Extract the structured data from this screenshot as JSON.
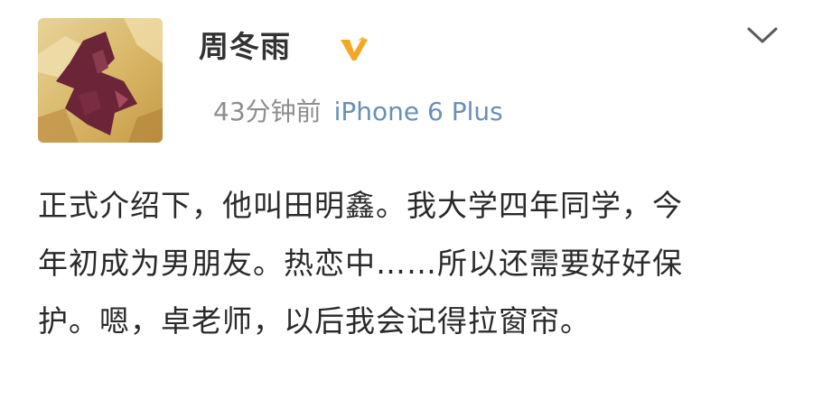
{
  "post": {
    "username": "周冬雨",
    "verified_badge": "V",
    "timestamp": "43分钟前",
    "source": "iPhone 6 Plus",
    "content_lines": [
      "正式介绍下，他叫田明鑫。我大学四年同学，今",
      "年初成为男朋友。热恋中……所以还需要好好保",
      "护。嗯，卓老师，以后我会记得拉窗帘。"
    ]
  },
  "icons": {
    "verified": "verified-v-icon",
    "menu": "chevron-down-icon"
  },
  "colors": {
    "username": "#333333",
    "verified": "#f5a623",
    "source_link": "#6a8fb7",
    "timestamp": "#8d8d8d",
    "body_text": "#2a2a2a"
  }
}
